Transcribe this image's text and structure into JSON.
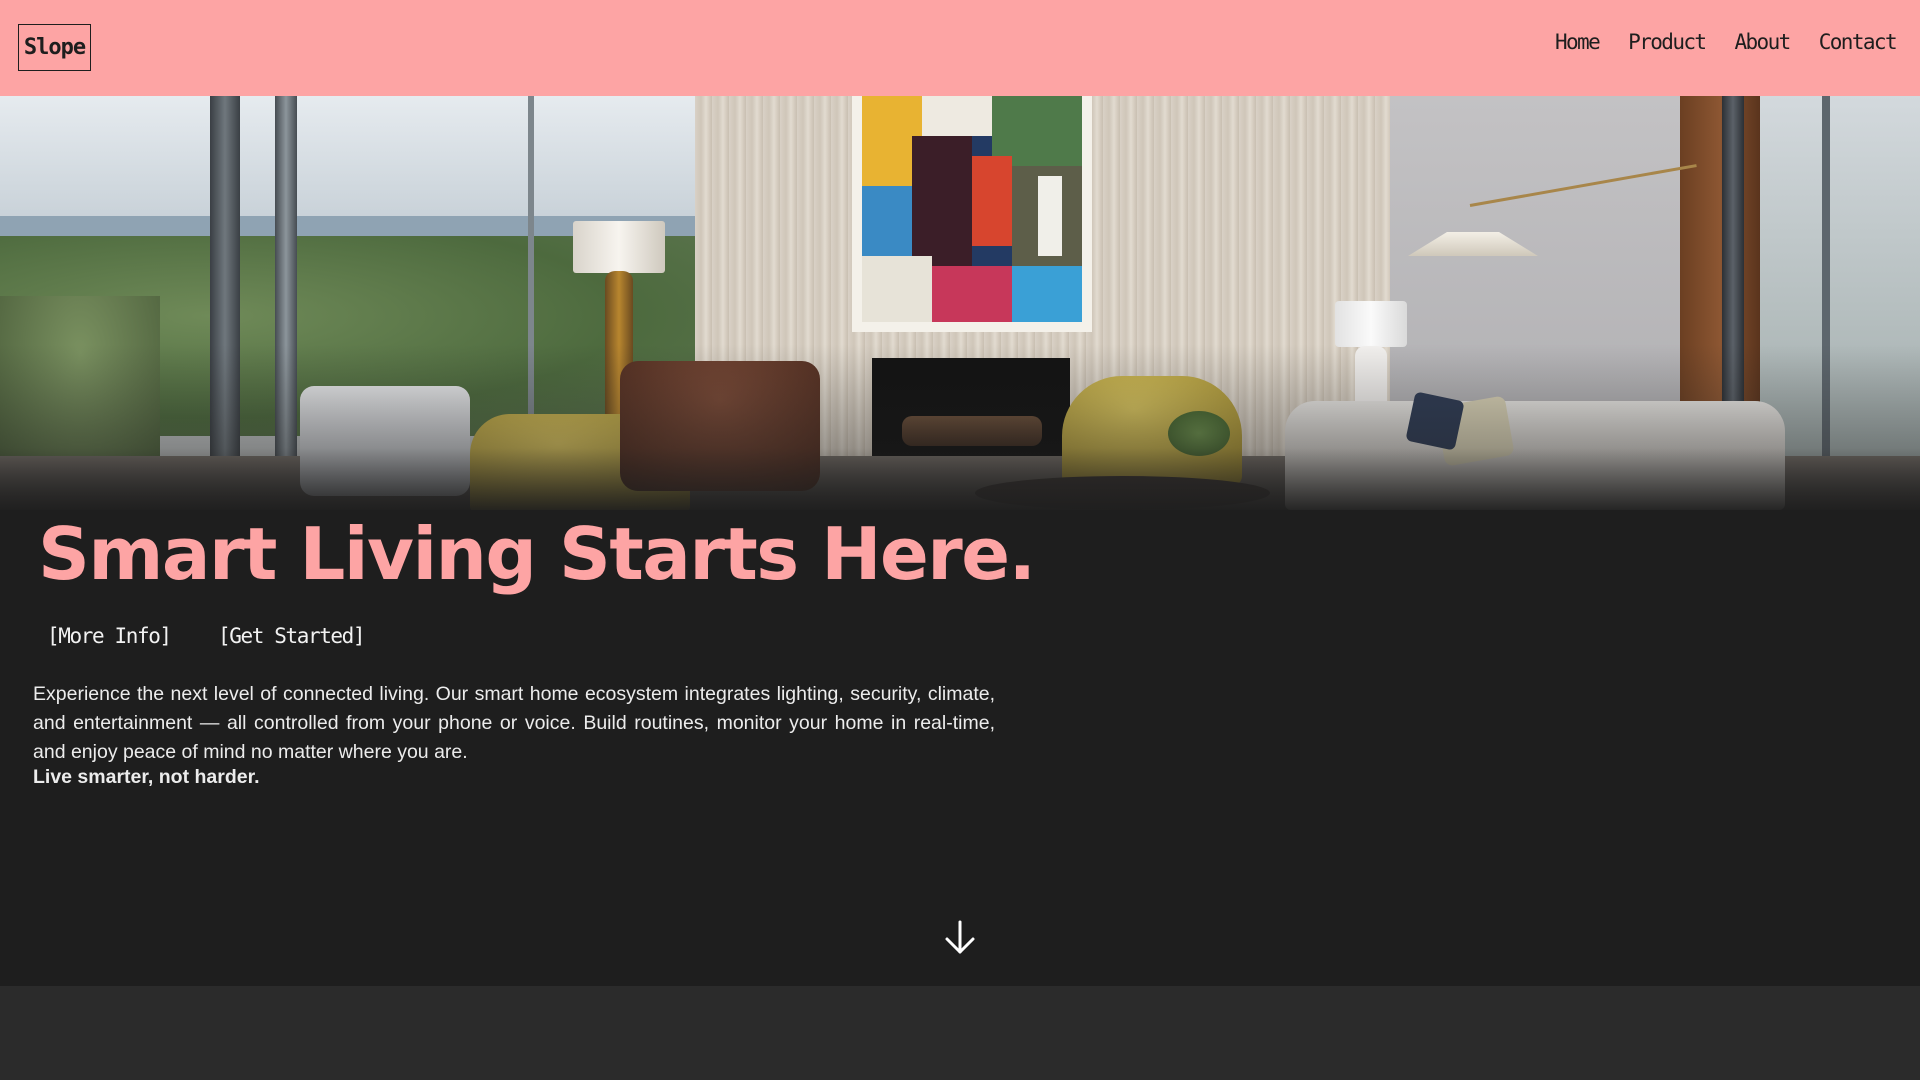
{
  "brand": {
    "logo_text": "Slope",
    "primary_color": "#fda4a4",
    "background_color": "#1e1e1e"
  },
  "nav": {
    "items": [
      {
        "label": "Home"
      },
      {
        "label": "Product"
      },
      {
        "label": "About"
      },
      {
        "label": "Contact"
      }
    ]
  },
  "hero": {
    "image_alt": "Modern living room with fireplace, abstract painting, yellow armchairs and ocean view",
    "headline": "Smart Living Starts Here.",
    "buttons": {
      "more_info": "[More Info]",
      "get_started": "[Get Started]"
    },
    "description": "Experience the next level of connected living. Our smart home ecosystem integrates lighting, security, climate, and entertainment — all controlled from your phone or voice. Build routines, monitor your home in real-time, and enjoy peace of mind no matter where you are.",
    "tagline": "Live smarter, not harder.",
    "scroll_icon": "arrow-down-icon"
  }
}
